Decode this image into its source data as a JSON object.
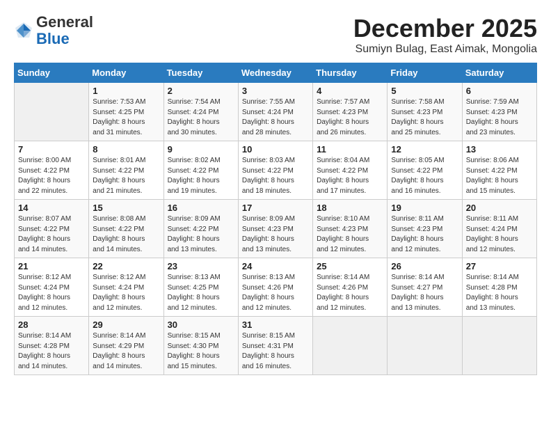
{
  "logo": {
    "general": "General",
    "blue": "Blue"
  },
  "header": {
    "month": "December 2025",
    "location": "Sumiyn Bulag, East Aimak, Mongolia"
  },
  "weekdays": [
    "Sunday",
    "Monday",
    "Tuesday",
    "Wednesday",
    "Thursday",
    "Friday",
    "Saturday"
  ],
  "weeks": [
    [
      {
        "day": "",
        "info": ""
      },
      {
        "day": "1",
        "info": "Sunrise: 7:53 AM\nSunset: 4:25 PM\nDaylight: 8 hours\nand 31 minutes."
      },
      {
        "day": "2",
        "info": "Sunrise: 7:54 AM\nSunset: 4:24 PM\nDaylight: 8 hours\nand 30 minutes."
      },
      {
        "day": "3",
        "info": "Sunrise: 7:55 AM\nSunset: 4:24 PM\nDaylight: 8 hours\nand 28 minutes."
      },
      {
        "day": "4",
        "info": "Sunrise: 7:57 AM\nSunset: 4:23 PM\nDaylight: 8 hours\nand 26 minutes."
      },
      {
        "day": "5",
        "info": "Sunrise: 7:58 AM\nSunset: 4:23 PM\nDaylight: 8 hours\nand 25 minutes."
      },
      {
        "day": "6",
        "info": "Sunrise: 7:59 AM\nSunset: 4:23 PM\nDaylight: 8 hours\nand 23 minutes."
      }
    ],
    [
      {
        "day": "7",
        "info": "Sunrise: 8:00 AM\nSunset: 4:22 PM\nDaylight: 8 hours\nand 22 minutes."
      },
      {
        "day": "8",
        "info": "Sunrise: 8:01 AM\nSunset: 4:22 PM\nDaylight: 8 hours\nand 21 minutes."
      },
      {
        "day": "9",
        "info": "Sunrise: 8:02 AM\nSunset: 4:22 PM\nDaylight: 8 hours\nand 19 minutes."
      },
      {
        "day": "10",
        "info": "Sunrise: 8:03 AM\nSunset: 4:22 PM\nDaylight: 8 hours\nand 18 minutes."
      },
      {
        "day": "11",
        "info": "Sunrise: 8:04 AM\nSunset: 4:22 PM\nDaylight: 8 hours\nand 17 minutes."
      },
      {
        "day": "12",
        "info": "Sunrise: 8:05 AM\nSunset: 4:22 PM\nDaylight: 8 hours\nand 16 minutes."
      },
      {
        "day": "13",
        "info": "Sunrise: 8:06 AM\nSunset: 4:22 PM\nDaylight: 8 hours\nand 15 minutes."
      }
    ],
    [
      {
        "day": "14",
        "info": "Sunrise: 8:07 AM\nSunset: 4:22 PM\nDaylight: 8 hours\nand 14 minutes."
      },
      {
        "day": "15",
        "info": "Sunrise: 8:08 AM\nSunset: 4:22 PM\nDaylight: 8 hours\nand 14 minutes."
      },
      {
        "day": "16",
        "info": "Sunrise: 8:09 AM\nSunset: 4:22 PM\nDaylight: 8 hours\nand 13 minutes."
      },
      {
        "day": "17",
        "info": "Sunrise: 8:09 AM\nSunset: 4:23 PM\nDaylight: 8 hours\nand 13 minutes."
      },
      {
        "day": "18",
        "info": "Sunrise: 8:10 AM\nSunset: 4:23 PM\nDaylight: 8 hours\nand 12 minutes."
      },
      {
        "day": "19",
        "info": "Sunrise: 8:11 AM\nSunset: 4:23 PM\nDaylight: 8 hours\nand 12 minutes."
      },
      {
        "day": "20",
        "info": "Sunrise: 8:11 AM\nSunset: 4:24 PM\nDaylight: 8 hours\nand 12 minutes."
      }
    ],
    [
      {
        "day": "21",
        "info": "Sunrise: 8:12 AM\nSunset: 4:24 PM\nDaylight: 8 hours\nand 12 minutes."
      },
      {
        "day": "22",
        "info": "Sunrise: 8:12 AM\nSunset: 4:24 PM\nDaylight: 8 hours\nand 12 minutes."
      },
      {
        "day": "23",
        "info": "Sunrise: 8:13 AM\nSunset: 4:25 PM\nDaylight: 8 hours\nand 12 minutes."
      },
      {
        "day": "24",
        "info": "Sunrise: 8:13 AM\nSunset: 4:26 PM\nDaylight: 8 hours\nand 12 minutes."
      },
      {
        "day": "25",
        "info": "Sunrise: 8:14 AM\nSunset: 4:26 PM\nDaylight: 8 hours\nand 12 minutes."
      },
      {
        "day": "26",
        "info": "Sunrise: 8:14 AM\nSunset: 4:27 PM\nDaylight: 8 hours\nand 13 minutes."
      },
      {
        "day": "27",
        "info": "Sunrise: 8:14 AM\nSunset: 4:28 PM\nDaylight: 8 hours\nand 13 minutes."
      }
    ],
    [
      {
        "day": "28",
        "info": "Sunrise: 8:14 AM\nSunset: 4:28 PM\nDaylight: 8 hours\nand 14 minutes."
      },
      {
        "day": "29",
        "info": "Sunrise: 8:14 AM\nSunset: 4:29 PM\nDaylight: 8 hours\nand 14 minutes."
      },
      {
        "day": "30",
        "info": "Sunrise: 8:15 AM\nSunset: 4:30 PM\nDaylight: 8 hours\nand 15 minutes."
      },
      {
        "day": "31",
        "info": "Sunrise: 8:15 AM\nSunset: 4:31 PM\nDaylight: 8 hours\nand 16 minutes."
      },
      {
        "day": "",
        "info": ""
      },
      {
        "day": "",
        "info": ""
      },
      {
        "day": "",
        "info": ""
      }
    ]
  ]
}
